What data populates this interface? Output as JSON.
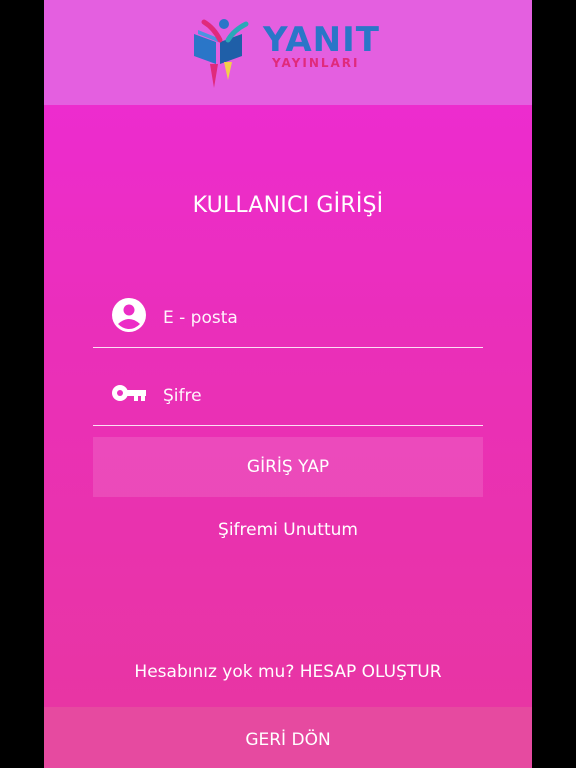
{
  "brand": {
    "name": "YANIT",
    "sub": "YAYINLARI",
    "colors": {
      "blue": "#2a76c8",
      "pink": "#e02a7c",
      "header_bg": "#e45fe0"
    }
  },
  "login": {
    "title": "KULLANICI GİRİŞİ",
    "email": {
      "placeholder": "E - posta",
      "value": "",
      "icon": "user-circle-icon"
    },
    "password": {
      "placeholder": "Şifre",
      "value": "",
      "icon": "key-icon"
    },
    "submit_label": "GİRİŞ YAP",
    "forgot_label": "Şifremi Unuttum",
    "no_account_text": "Hesabınız yok mu?",
    "signup_label": "HESAP OLUŞTUR"
  },
  "footer": {
    "back_label": "GERİ DÖN"
  }
}
